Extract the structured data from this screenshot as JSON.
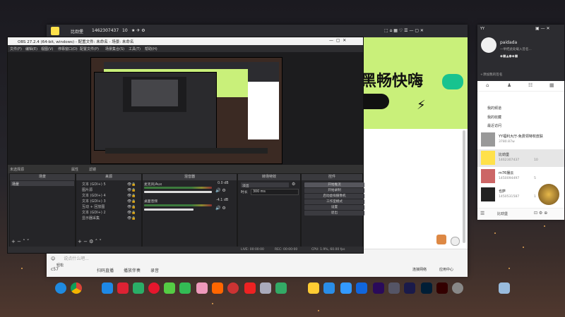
{
  "yy": {
    "top_name": "比劲堡",
    "top_id": "1462307437",
    "top_count": "10",
    "banner_text": "黑畅快嗨",
    "chat_placeholder": "说点什么吧...",
    "chat_level_label": "轻松",
    "bottom_items": [
      "扫码直播",
      "播放伴奏",
      "录音"
    ],
    "bottom_status": "连接网络",
    "bottom_apply": "应用中心",
    "bottom_count": "c57"
  },
  "obs": {
    "title": "OBS 27.2.4 (64-bit, windows) - 配置文件: 未命名 - 场景: 未命名",
    "menu": [
      "文件(F)",
      "编辑(E)",
      "视图(V)",
      "停靠窗口(D)",
      "配置文件(P)",
      "场景集合(S)",
      "工具(T)",
      "帮助(H)"
    ],
    "scene_bar": {
      "label": "未选择源",
      "prop": "属性",
      "filter": "滤镜"
    },
    "docks": {
      "scenes": "场景",
      "sources": "来源",
      "mixer": "混音器",
      "transitions": "转场特效",
      "controls": "控件"
    },
    "scene_item": "场景",
    "sources": [
      "文本 (GDI+) 5",
      "图片源",
      "文本 (GDI+) 4",
      "文本 (GDI+) 3",
      "互动 + 回放图",
      "文本 (GDI+) 2",
      "显示器采集"
    ],
    "mixer": [
      {
        "name": "麦克风/Aux",
        "db": "0.0 dB"
      },
      {
        "name": "桌面音频",
        "db": "-4.1 dB"
      }
    ],
    "transition": {
      "type": "淡出",
      "duration_label": "时长",
      "duration": "300 ms"
    },
    "controls": [
      "开始推流",
      "开始录制",
      "启动虚拟摄像机",
      "工作室模式",
      "设置",
      "退出"
    ],
    "status": {
      "live": "LIVE: 00:00:00",
      "rec": "REC: 00:00:00",
      "cpu": "CPU: 1.9%, 60.00 fps"
    }
  },
  "profile": {
    "label": "YY",
    "name": "paidada",
    "sign": "一举把此处载入签名...",
    "tabs_label": "+添加我的签名",
    "menu": [
      "我的频道",
      "我的收藏",
      "最近访问"
    ],
    "users": [
      {
        "name": "YY福利大厅-免费领特权皮肤",
        "sub": "3780.87w"
      },
      {
        "name": "比劲堡",
        "sub": "1462307437",
        "count": "10"
      },
      {
        "name": "m76播云",
        "sub": "1450094497",
        "count": "5"
      },
      {
        "name": "也萨",
        "sub": "1450531587",
        "count": "1"
      }
    ],
    "footer_label": "比劲堡"
  }
}
